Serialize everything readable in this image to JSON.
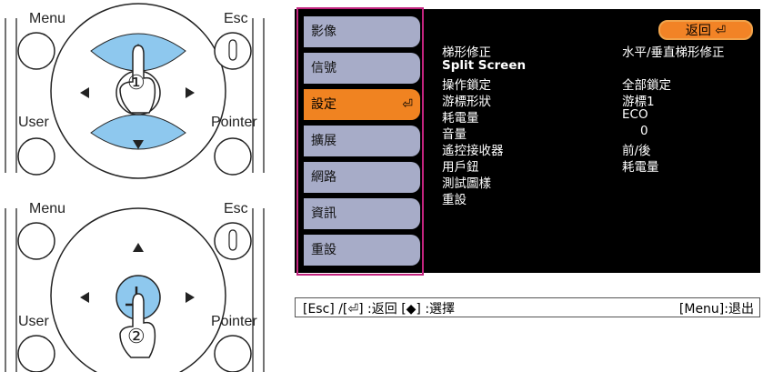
{
  "remote_top": {
    "menu_label": "Menu",
    "esc_label": "Esc",
    "user_label": "User",
    "pointer_label": "Pointer",
    "step_number": "①"
  },
  "remote_bottom": {
    "menu_label": "Menu",
    "esc_label": "Esc",
    "user_label": "User",
    "pointer_label": "Pointer",
    "step_number": "②"
  },
  "osd": {
    "sidebar": [
      {
        "label": "影像"
      },
      {
        "label": "信號"
      },
      {
        "label": "設定",
        "active": true
      },
      {
        "label": "擴展"
      },
      {
        "label": "網路"
      },
      {
        "label": "資訊"
      },
      {
        "label": "重設"
      }
    ],
    "back_button": "返回",
    "settings": [
      {
        "label": "梯形修正",
        "value": "水平/垂直梯形修正"
      },
      {
        "label": "Split Screen",
        "value": ""
      },
      {
        "label": "操作鎖定",
        "value": "全部鎖定"
      },
      {
        "label": "游標形狀",
        "value": "游標1"
      },
      {
        "label": "耗電量",
        "value": "ECO"
      },
      {
        "label": "音量",
        "value": "0"
      },
      {
        "label": "遙控接收器",
        "value": "前/後"
      },
      {
        "label": "用戶鈕",
        "value": "耗電量"
      },
      {
        "label": "測試圖樣",
        "value": ""
      },
      {
        "label": "重設",
        "value": ""
      }
    ]
  },
  "footer": {
    "left": "[Esc] /[⏎] :返回 [◆] :選擇",
    "right": "[Menu]:退出"
  },
  "colors": {
    "sidebar_item": "#a7acc8",
    "active_item": "#f08321",
    "osd_background": "#000000",
    "highlight_border": "#c2247e",
    "dpad_highlight": "#8ec8ee"
  }
}
